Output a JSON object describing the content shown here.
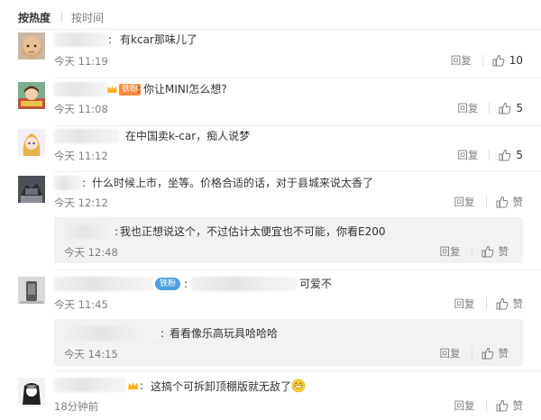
{
  "sort": {
    "active": "按热度",
    "inactive": "按时间"
  },
  "comments": [
    {
      "text": "有kcar那味儿了",
      "time": "今天 11:19",
      "reply": "回复",
      "likes": "10"
    },
    {
      "badge": "铁粉",
      "text": "你让MINI怎么想?",
      "time": "今天 11:08",
      "reply": "回复",
      "likes": "5"
    },
    {
      "text": "在中国卖k-car，痴人说梦",
      "time": "今天 11:12",
      "reply": "回复",
      "likes": "5"
    },
    {
      "text": "什么时候上市，坐等。价格合适的话，对于县城来说太香了",
      "time": "今天 12:12",
      "reply": "回复",
      "likes": "赞",
      "subreply": {
        "text": "我也正想说这个，不过估计太便宜也不可能，你看E200",
        "time": "今天 12:48",
        "reply": "回复",
        "likes": "赞"
      }
    },
    {
      "badge": "铁粉",
      "text": "可爱不",
      "time": "今天 11:45",
      "reply": "回复",
      "likes": "赞",
      "subreply": {
        "text": "看看像乐高玩具哈哈哈",
        "time": "今天 14:15",
        "reply": "回复",
        "likes": "赞"
      }
    },
    {
      "text": "这搞个可拆卸顶棚版就无敌了",
      "time": "18分钟前",
      "reply": "回复",
      "likes": "赞"
    }
  ],
  "colors": {
    "text": "#333333",
    "meta": "#808080",
    "reply_bg": "#f2f2f5",
    "badge_orange": "#ff8a3d",
    "badge_blue": "#4fa0e0"
  },
  "icons": [
    "thumbs-up-icon",
    "crown-icon",
    "grin-emoji-icon"
  ]
}
